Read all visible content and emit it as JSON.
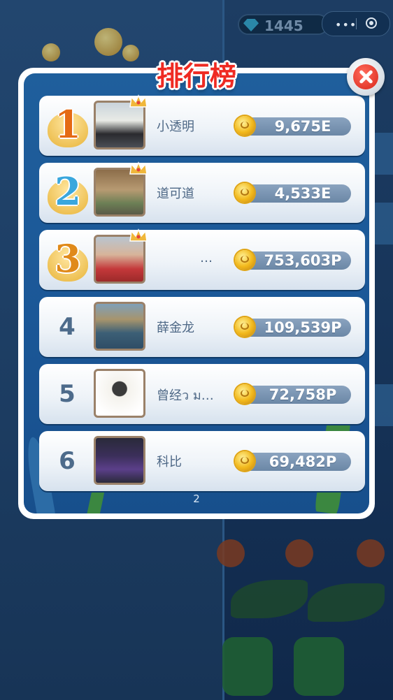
{
  "background": {
    "gem_count": "1445"
  },
  "leaderboard": {
    "title": "排行榜",
    "page": "2",
    "entries": [
      {
        "rank": "1",
        "name": "小透明",
        "score": "9,675E",
        "medal": true,
        "crown": true
      },
      {
        "rank": "2",
        "name": "道可道",
        "score": "4,533E",
        "medal": true,
        "crown": true
      },
      {
        "rank": "3",
        "name": "…",
        "score": "753,603P",
        "medal": true,
        "crown": true
      },
      {
        "rank": "4",
        "name": "薛金龙",
        "score": "109,539P",
        "medal": false,
        "crown": false
      },
      {
        "rank": "5",
        "name": "曾经ว ม…",
        "score": "72,758P",
        "medal": false,
        "crown": false
      },
      {
        "rank": "6",
        "name": "科比",
        "score": "69,482P",
        "medal": false,
        "crown": false
      }
    ]
  },
  "colors": {
    "title_red": "#ef2a22",
    "panel_blue": "#1b5797",
    "gold_medal": "#e8b43a",
    "silver_medal": "#59b8e6",
    "bronze_medal": "#e59a2a"
  },
  "icons": [
    "close-icon",
    "coin-icon",
    "crown-icon",
    "gem-icon",
    "more-icon",
    "target-icon"
  ]
}
